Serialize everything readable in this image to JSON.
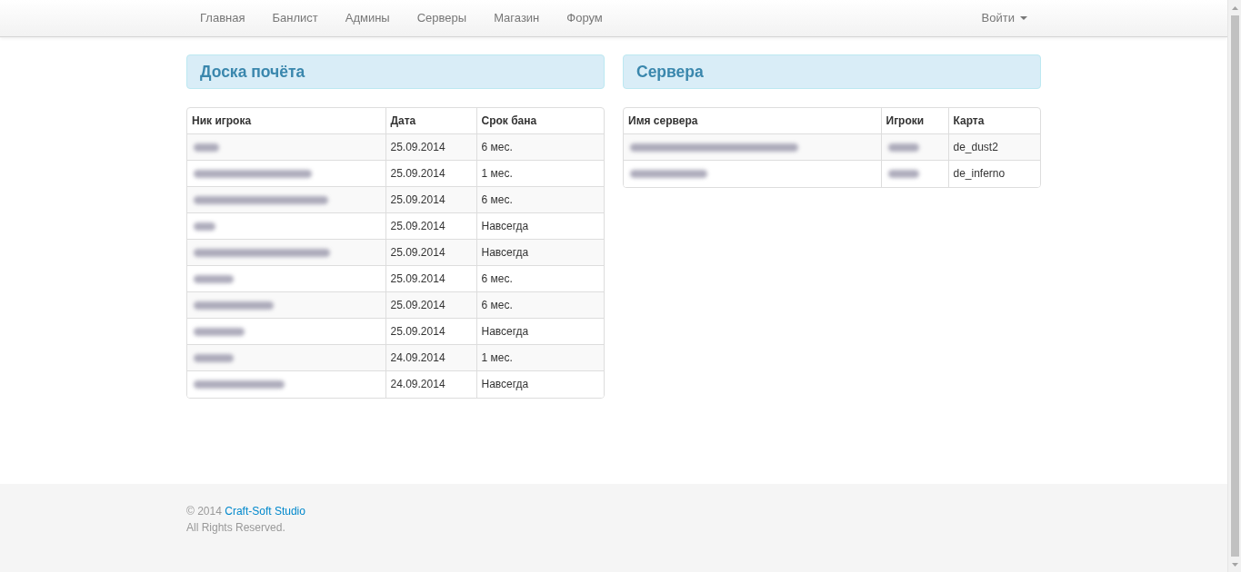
{
  "nav": {
    "links": [
      {
        "label": "Главная"
      },
      {
        "label": "Банлист"
      },
      {
        "label": "Админы"
      },
      {
        "label": "Серверы"
      },
      {
        "label": "Магазин"
      },
      {
        "label": "Форум"
      }
    ],
    "login": {
      "label": "Войти"
    }
  },
  "honor_board": {
    "title": "Доска почёта",
    "columns": [
      "Ник игрока",
      "Дата",
      "Срок бана"
    ],
    "rows": [
      {
        "date": "25.09.2014",
        "term": "6 мес."
      },
      {
        "date": "25.09.2014",
        "term": "1 мес."
      },
      {
        "date": "25.09.2014",
        "term": "6 мес."
      },
      {
        "date": "25.09.2014",
        "term": "Навсегда"
      },
      {
        "date": "25.09.2014",
        "term": "Навсегда"
      },
      {
        "date": "25.09.2014",
        "term": "6 мес."
      },
      {
        "date": "25.09.2014",
        "term": "6 мес."
      },
      {
        "date": "25.09.2014",
        "term": "Навсегда"
      },
      {
        "date": "24.09.2014",
        "term": "1 мес."
      },
      {
        "date": "24.09.2014",
        "term": "Навсегда"
      }
    ]
  },
  "servers": {
    "title": "Сервера",
    "columns": [
      "Имя сервера",
      "Игроки",
      "Карта"
    ],
    "rows": [
      {
        "map": "de_dust2"
      },
      {
        "map": "de_inferno"
      }
    ]
  },
  "footer": {
    "copyright": "© 2014",
    "link": "Craft-Soft Studio",
    "rights": "All Rights Reserved."
  }
}
